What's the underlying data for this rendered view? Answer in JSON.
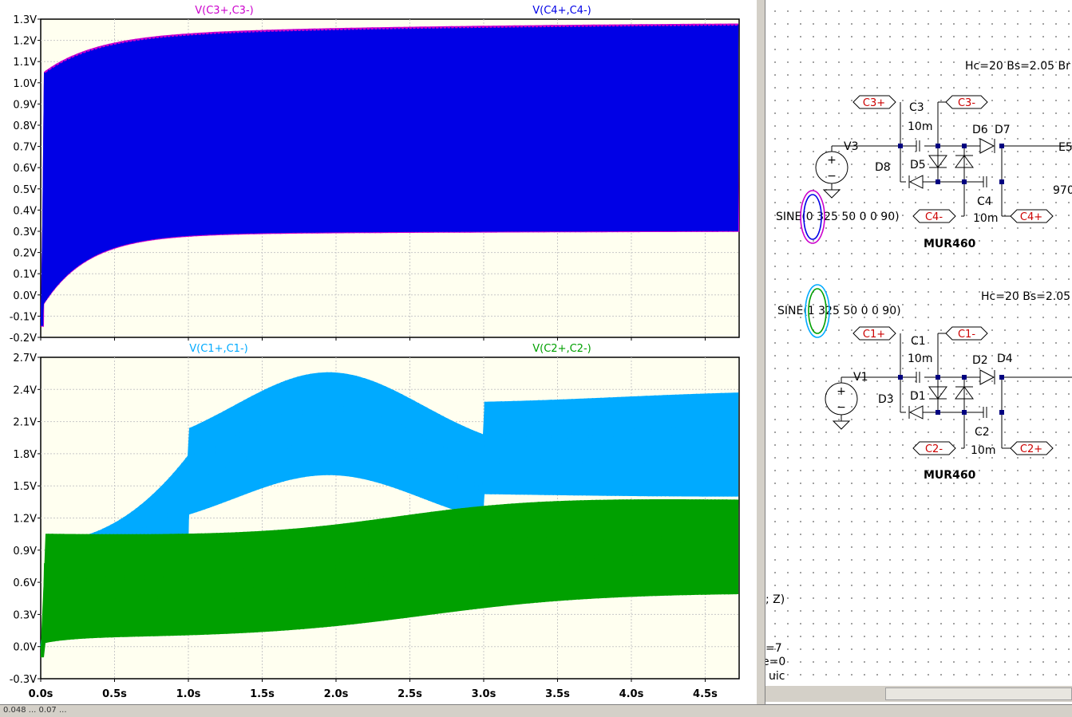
{
  "plots": [
    {
      "id": "top",
      "y_ticks": [
        "1.3V",
        "1.2V",
        "1.1V",
        "1.0V",
        "0.9V",
        "0.8V",
        "0.7V",
        "0.6V",
        "0.5V",
        "0.4V",
        "0.3V",
        "0.2V",
        "0.1V",
        "0.0V",
        "-0.1V",
        "-0.2V"
      ],
      "ylim": [
        -0.2,
        1.3
      ],
      "traces": [
        {
          "name": "V(C3+,C3-)",
          "color": "#cc00cc"
        },
        {
          "name": "V(C4+,C4-)",
          "color": "#0000e6"
        }
      ]
    },
    {
      "id": "bottom",
      "y_ticks": [
        "2.7V",
        "2.4V",
        "2.1V",
        "1.8V",
        "1.5V",
        "1.2V",
        "0.9V",
        "0.6V",
        "0.3V",
        "0.0V",
        "-0.3V"
      ],
      "ylim": [
        -0.3,
        2.7
      ],
      "traces": [
        {
          "name": "V(C1+,C1-)",
          "color": "#00aaff"
        },
        {
          "name": "V(C2+,C2-)",
          "color": "#00a000"
        }
      ]
    }
  ],
  "x_ticks": [
    "0.0s",
    "0.5s",
    "1.0s",
    "1.5s",
    "2.0s",
    "2.5s",
    "3.0s",
    "3.5s",
    "4.0s",
    "4.5s"
  ],
  "xlim": [
    0,
    4.73
  ],
  "colors": {
    "plot_bg": "#fffff0",
    "grid": "#c8c8c8",
    "trace_blue": "#0000e6",
    "trace_magenta": "#cc00cc",
    "trace_cyan": "#00aaff",
    "trace_green": "#00a000",
    "netlabel": "#cc0000"
  },
  "schematic": {
    "top": {
      "core_params": "Hc=20 Bs=2.05 Br",
      "source_label": "V3",
      "source_value": "SINE(0 325 50 0 0 90)",
      "diode_model": "MUR460",
      "labels": {
        "c3p": "C3+",
        "c3m": "C3-",
        "c4m": "C4-",
        "c4p": "C4+",
        "c3": "C3",
        "c3v": "10m",
        "c4": "C4",
        "c4v": "10m",
        "d5": "D5",
        "d6": "D6",
        "d7": "D7",
        "d8": "D8",
        "e5": "E5",
        "v970": "970"
      }
    },
    "bottom": {
      "core_params": "Hc=20 Bs=2.05",
      "source_label": "V1",
      "source_value": "SINE(1 325 50 0 0 90)",
      "diode_model": "MUR460",
      "labels": {
        "c1p": "C1+",
        "c1m": "C1-",
        "c2m": "C2-",
        "c2p": "C2+",
        "c1": "C1",
        "c1v": "10m",
        "c2": "C2",
        "c2v": "10m",
        "d1": "D1",
        "d2": "D2",
        "d3": "D3",
        "d4": "D4"
      }
    },
    "fragments": {
      "z": "; Z)",
      "eq7": "=7",
      "eq0": "e=0",
      "uic": "uic"
    }
  },
  "status": {
    "text": "0.048 ... 0.07 ..."
  }
}
